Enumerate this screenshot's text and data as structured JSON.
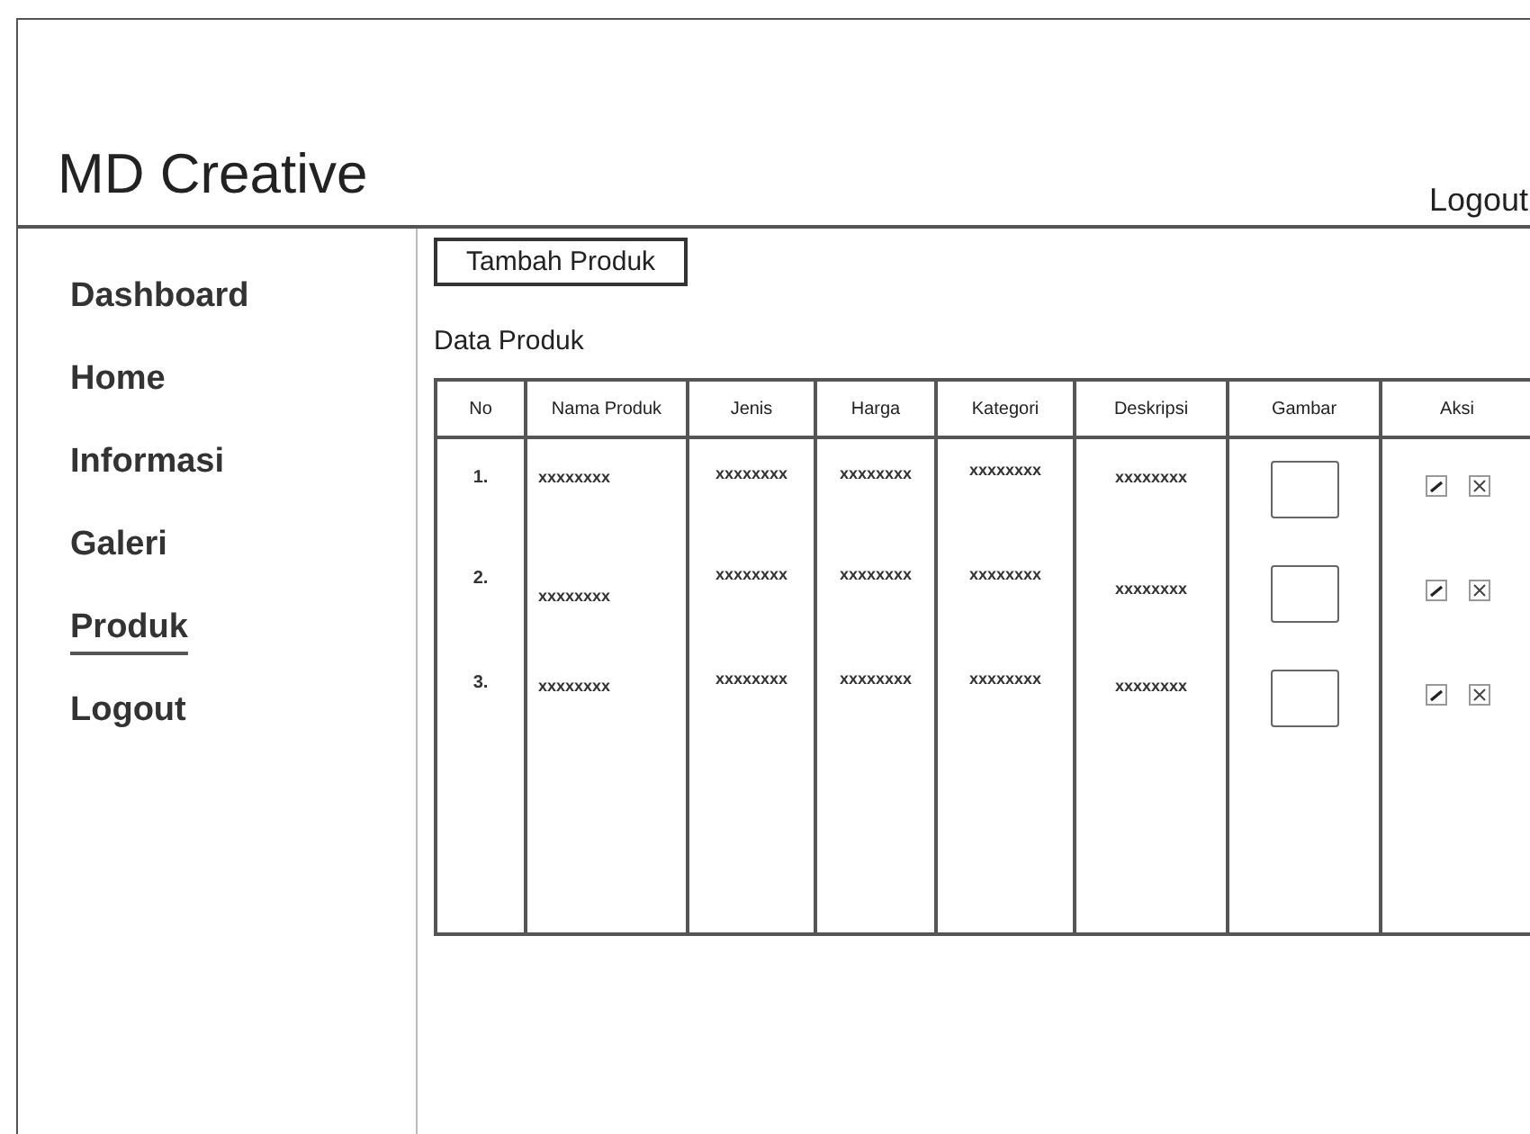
{
  "header": {
    "title": "MD Creative",
    "logout": "Logout"
  },
  "sidebar": {
    "items": [
      {
        "label": "Dashboard",
        "selected": false
      },
      {
        "label": "Home",
        "selected": false
      },
      {
        "label": "Informasi",
        "selected": false
      },
      {
        "label": "Galeri",
        "selected": false
      },
      {
        "label": "Produk",
        "selected": true
      },
      {
        "label": "Logout",
        "selected": false
      }
    ]
  },
  "add_button": "Tambah Produk",
  "section_title": "Data Produk",
  "table": {
    "columns": [
      "No",
      "Nama Produk",
      "Jenis",
      "Harga",
      "Kategori",
      "Deskripsi",
      "Gambar",
      "Aksi"
    ],
    "rows": [
      {
        "no": "1.",
        "nama": "xxxxxxxx",
        "jenis": "xxxxxxxx",
        "harga": "xxxxxxxx",
        "kategori": "xxxxxxxx",
        "deskripsi": "xxxxxxxx"
      },
      {
        "no": "2.",
        "nama": "xxxxxxxx",
        "jenis": "xxxxxxxx",
        "harga": "xxxxxxxx",
        "kategori": "xxxxxxxx",
        "deskripsi": "xxxxxxxx"
      },
      {
        "no": "3.",
        "nama": "xxxxxxxx",
        "jenis": "xxxxxxxx",
        "harga": "xxxxxxxx",
        "kategori": "xxxxxxxx",
        "deskripsi": "xxxxxxxx"
      }
    ]
  }
}
